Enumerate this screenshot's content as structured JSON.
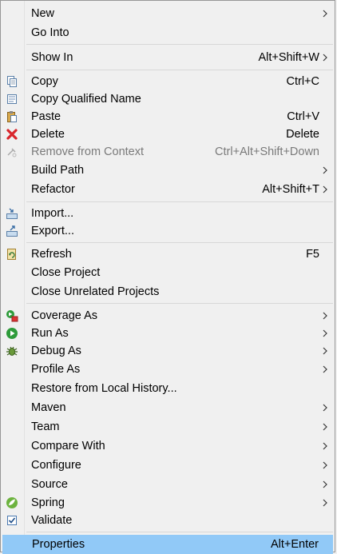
{
  "menu": {
    "new": {
      "label": "New"
    },
    "go_into": {
      "label": "Go Into"
    },
    "show_in": {
      "label": "Show In",
      "shortcut": "Alt+Shift+W"
    },
    "copy": {
      "label": "Copy",
      "shortcut": "Ctrl+C",
      "icon": "copy-icon"
    },
    "copy_qualified": {
      "label": "Copy Qualified Name",
      "icon": "copy-qualified-name-icon"
    },
    "paste": {
      "label": "Paste",
      "shortcut": "Ctrl+V",
      "icon": "paste-icon"
    },
    "delete": {
      "label": "Delete",
      "shortcut": "Delete",
      "icon": "delete-icon"
    },
    "remove_context": {
      "label": "Remove from Context",
      "shortcut": "Ctrl+Alt+Shift+Down",
      "icon": "remove-context-icon",
      "disabled": true
    },
    "build_path": {
      "label": "Build Path"
    },
    "refactor": {
      "label": "Refactor",
      "shortcut": "Alt+Shift+T"
    },
    "import": {
      "label": "Import...",
      "icon": "import-icon"
    },
    "export": {
      "label": "Export...",
      "icon": "export-icon"
    },
    "refresh": {
      "label": "Refresh",
      "shortcut": "F5",
      "icon": "refresh-icon"
    },
    "close_project": {
      "label": "Close Project"
    },
    "close_unrelated": {
      "label": "Close Unrelated Projects"
    },
    "coverage_as": {
      "label": "Coverage As",
      "icon": "coverage-icon"
    },
    "run_as": {
      "label": "Run As",
      "icon": "run-icon"
    },
    "debug_as": {
      "label": "Debug As",
      "icon": "debug-icon"
    },
    "profile_as": {
      "label": "Profile As"
    },
    "restore_history": {
      "label": "Restore from Local History..."
    },
    "maven": {
      "label": "Maven"
    },
    "team": {
      "label": "Team"
    },
    "compare_with": {
      "label": "Compare With"
    },
    "configure": {
      "label": "Configure"
    },
    "source": {
      "label": "Source"
    },
    "spring": {
      "label": "Spring",
      "icon": "spring-icon"
    },
    "validate": {
      "label": "Validate",
      "icon": "checkbox-checked-icon"
    },
    "properties": {
      "label": "Properties",
      "shortcut": "Alt+Enter",
      "selected": true
    }
  },
  "colors": {
    "menu_bg": "#f0f0f0",
    "selected_bg": "#91c9f7",
    "disabled_text": "#7a7a7a",
    "separator": "#d7d7d7"
  }
}
